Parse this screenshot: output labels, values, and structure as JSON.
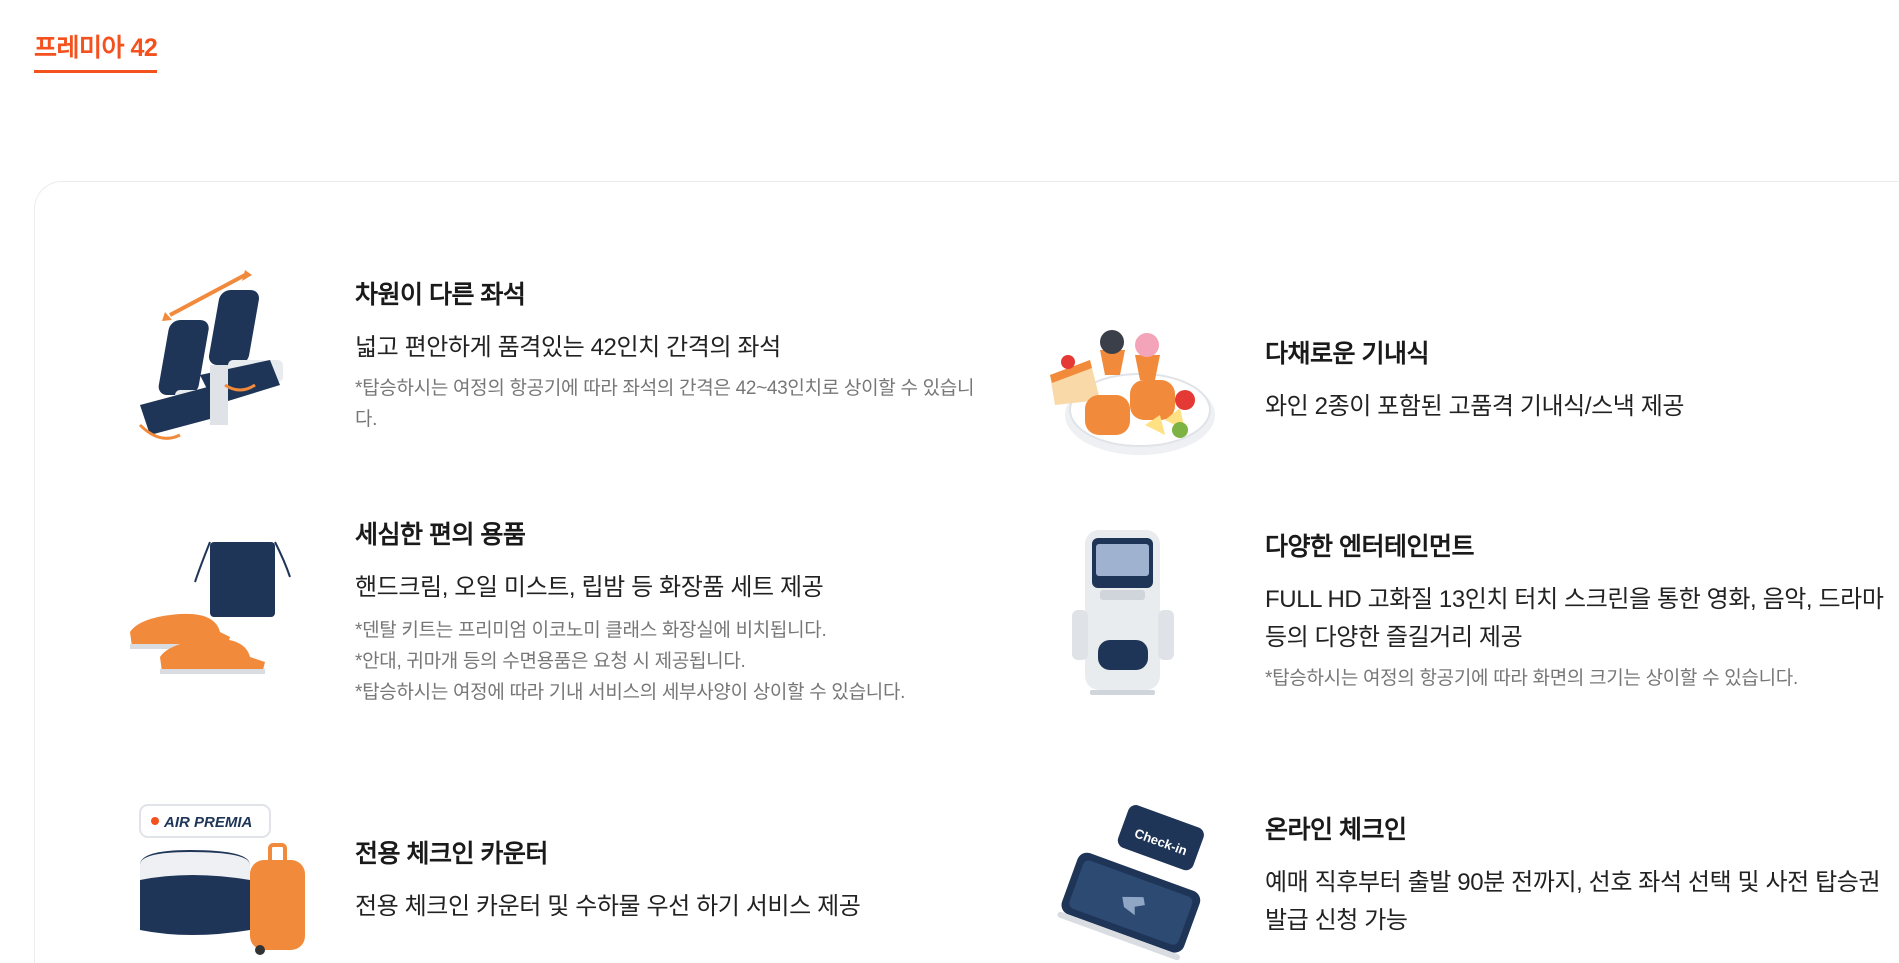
{
  "tab": {
    "title": "프레미아 42"
  },
  "colors": {
    "accent": "#f4511e",
    "navy": "#1f3557",
    "orange": "#f28a3c"
  },
  "features": [
    {
      "icon": "reclining-seats-icon",
      "title": "차원이 다른 좌석",
      "desc": "넓고 편안하게 품격있는 42인치 간격의 좌석",
      "notes": [
        "*탑승하시는 여정의 항공기에 따라 좌석의 간격은 42~43인치로 상이할 수 있습니다."
      ]
    },
    {
      "icon": "meal-plate-icon",
      "title": "다채로운 기내식",
      "desc": "와인 2종이 포함된 고품격 기내식/스낵 제공",
      "notes": []
    },
    {
      "icon": "amenity-kit-icon",
      "title": "세심한 편의 용품",
      "desc": "핸드크림, 오일 미스트, 립밤 등 화장품 세트 제공",
      "notes": [
        "*덴탈 키트는 프리미엄 이코노미 클래스 화장실에 비치됩니다.",
        "*안대, 귀마개 등의 수면용품은 요청 시 제공됩니다.",
        "*탑승하시는 여정에 따라 기내 서비스의 세부사양이 상이할 수 있습니다."
      ]
    },
    {
      "icon": "seatback-screen-icon",
      "title": "다양한 엔터테인먼트",
      "desc": "FULL HD 고화질 13인치 터치 스크린을 통한 영화, 음악, 드라마 등의 다양한 즐길거리 제공",
      "notes": [
        "*탑승하시는 여정의 항공기에 따라 화면의 크기는 상이할 수 있습니다."
      ]
    },
    {
      "icon": "checkin-counter-icon",
      "title": "전용 체크인 카운터",
      "desc": "전용 체크인 카운터 및 수하물 우선 하기 서비스 제공",
      "notes": [],
      "logo_text": "AIR PREMIA"
    },
    {
      "icon": "mobile-checkin-icon",
      "title": "온라인 체크인",
      "desc": "예매 직후부터 출발 90분 전까지, 선호 좌석 선택 및 사전 탑승권 발급 신청 가능",
      "notes": [],
      "badge_text": "Check-in"
    }
  ]
}
